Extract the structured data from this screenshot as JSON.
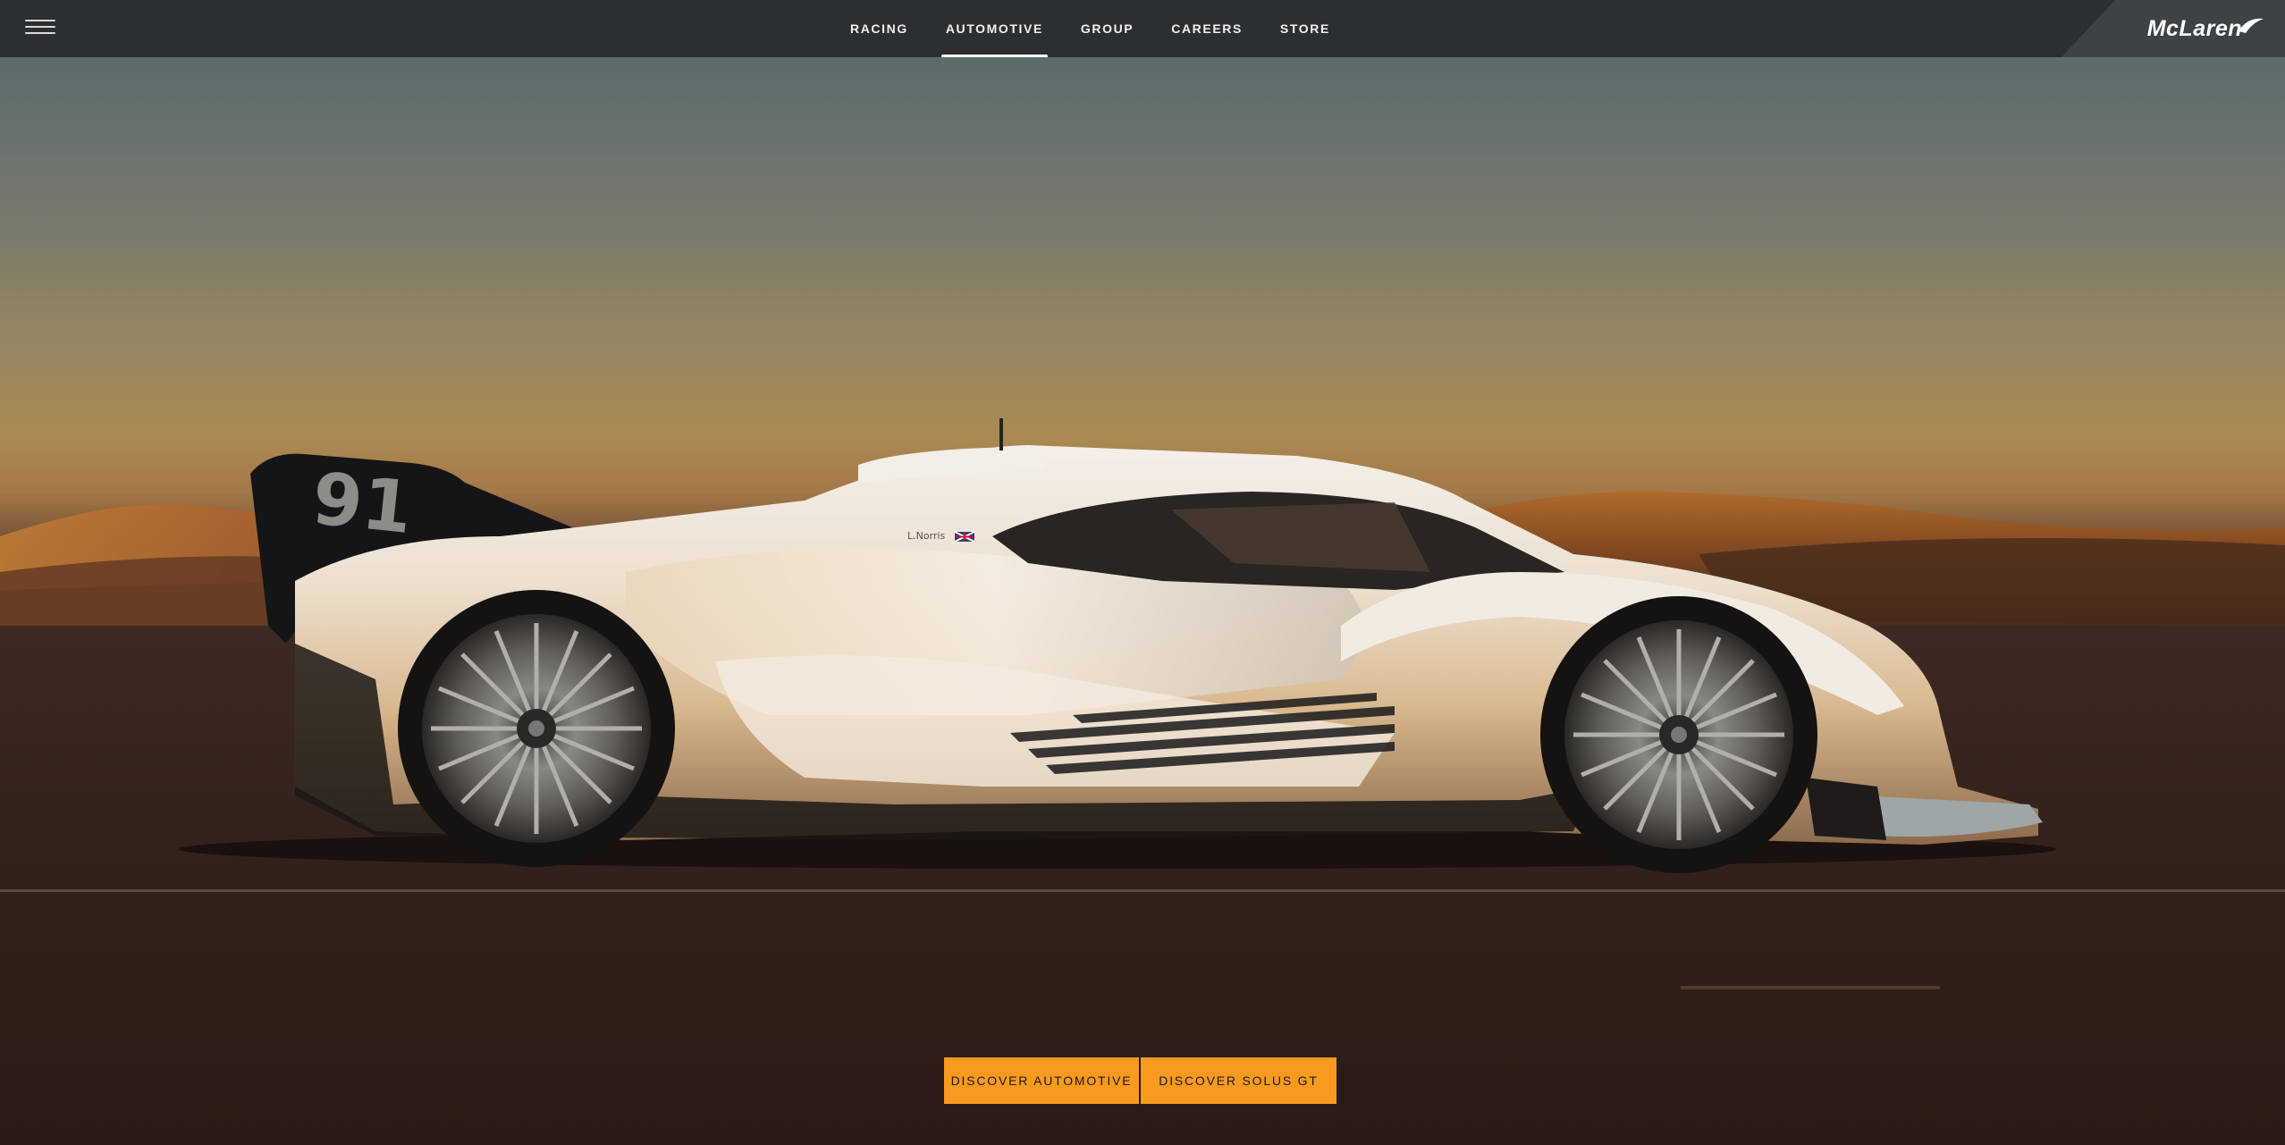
{
  "nav": {
    "menu_icon": "hamburger-menu-icon",
    "items": [
      {
        "label": "RACING",
        "active": false
      },
      {
        "label": "AUTOMOTIVE",
        "active": true
      },
      {
        "label": "GROUP",
        "active": false
      },
      {
        "label": "CAREERS",
        "active": false
      },
      {
        "label": "STORE",
        "active": false
      }
    ],
    "logo": "McLaren",
    "logo_icon": "speedmark-swoosh-icon"
  },
  "hero": {
    "image_subject": "white Solus GT race car in desert at sunset",
    "car_number": "91",
    "driver_tag": "L.Norris"
  },
  "cta": {
    "primary_label": "DISCOVER AUTOMOTIVE",
    "secondary_label": "DISCOVER SOLUS GT"
  },
  "colors": {
    "nav_bg": "#2a2d2f",
    "cta_bg": "#f79a1e",
    "accent_white": "#ffffff"
  }
}
